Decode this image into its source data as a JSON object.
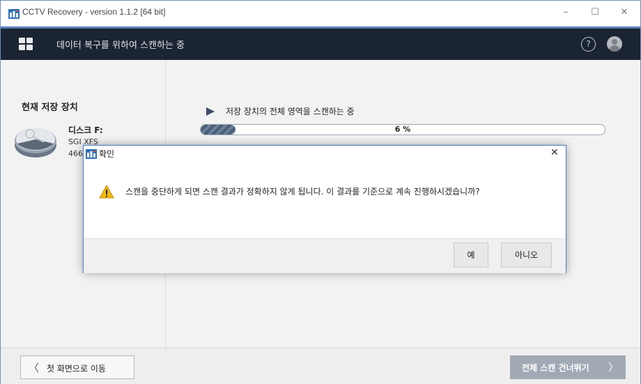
{
  "window": {
    "title": "CCTV Recovery - version 1.1.2 [64 bit]",
    "minimize_glyph": "–",
    "maximize_glyph": "☐",
    "close_glyph": "✕"
  },
  "header": {
    "title": "데이터 복구를 위하여 스캔하는 중",
    "help_glyph": "?",
    "icons": [
      "apps-grid-icon",
      "help-icon",
      "user-avatar-icon"
    ]
  },
  "left_panel": {
    "title": "현재 저장 장치",
    "device": {
      "name": "디스크 F:",
      "filesystem": "SGI XFS",
      "size": "466"
    }
  },
  "scan": {
    "label": "저장 장치의 전체 영역을 스캔하는 중",
    "progress_percent": 6,
    "progress_text": "6 %"
  },
  "footer": {
    "back_label": "첫 화면으로 이동",
    "back_glyph": "〈",
    "skip_label": "전체 스캔 건너뛰기",
    "skip_glyph": "〉"
  },
  "dialog": {
    "title": "확인",
    "close_glyph": "✕",
    "message": "스캔을 중단하게 되면 스캔 결과가 정확하지 않게 됩니다. 이 결과를 기준으로 계속 진행하시겠습니까?",
    "yes_label": "예",
    "no_label": "아니오",
    "icons": [
      "warning-icon"
    ]
  },
  "colors": {
    "header_bg": "#1a2432",
    "accent": "#5b80c2",
    "skip_button_bg": "#a1a9b4",
    "warning": "#f2b818"
  }
}
